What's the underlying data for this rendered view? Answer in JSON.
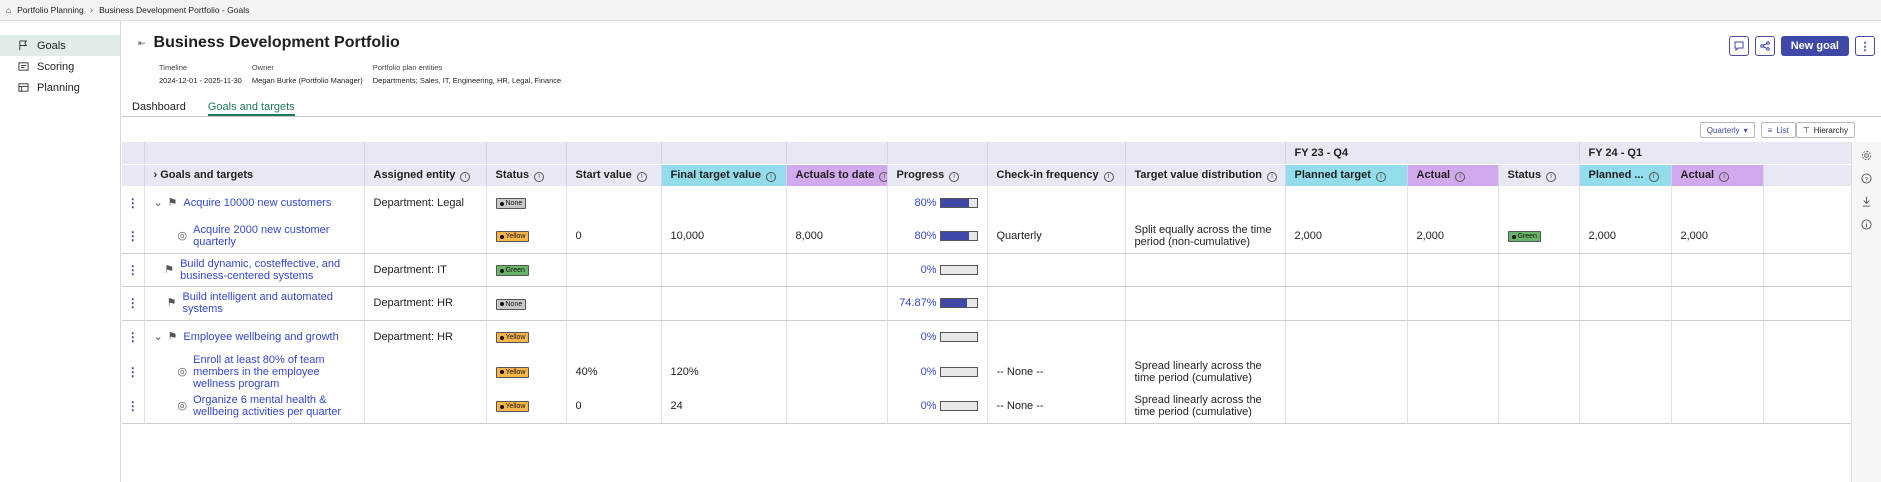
{
  "breadcrumb": {
    "root": "Portfolio Planning",
    "current": "Business Development Portfolio - Goals"
  },
  "sidebar": {
    "items": [
      {
        "label": "Goals",
        "active": true
      },
      {
        "label": "Scoring"
      },
      {
        "label": "Planning"
      }
    ]
  },
  "header": {
    "title": "Business Development Portfolio",
    "timeline_label": "Timeline",
    "timeline_value": "2024-12-01 - 2025-11-30",
    "owner_label": "Owner",
    "owner_value": "Megan Burke (Portfolio Manager)",
    "entities_label": "Portfolio plan entities",
    "entities_value": "Departments; Sales, IT, Engineering, HR, Legal, Finance",
    "new_goal_label": "New goal"
  },
  "tabs": [
    {
      "label": "Dashboard"
    },
    {
      "label": "Goals and targets",
      "active": true
    }
  ],
  "toolbar": {
    "period_select": "Quarterly",
    "list_label": "List",
    "hierarchy_label": "Hierarchy"
  },
  "columns": {
    "goals": "Goals and targets",
    "entity": "Assigned entity",
    "status": "Status",
    "start": "Start value",
    "final": "Final target value",
    "actuals": "Actuals to date",
    "progress": "Progress",
    "checkin": "Check-in frequency",
    "distribution": "Target value distribution",
    "p1_title": "FY 23 - Q4",
    "p1_planned": "Planned target",
    "p1_actual": "Actual",
    "p1_status": "Status",
    "p2_title": "FY 24 - Q1",
    "p2_planned": "Planned ...",
    "p2_actual": "Actual"
  },
  "rows": [
    {
      "goal": "Acquire 10000 new customers",
      "entity": "Department: Legal",
      "status": "None",
      "start": "",
      "final": "",
      "actuals": "",
      "progress": "80%",
      "checkin": "",
      "distribution": "",
      "p1_planned": "",
      "p1_actual": "",
      "p1_status": "",
      "p2_planned": "",
      "p2_actual": ""
    },
    {
      "goal": "Acquire 2000 new customer quarterly",
      "entity": "",
      "status": "Yellow",
      "start": "0",
      "final": "10,000",
      "actuals": "8,000",
      "progress": "80%",
      "checkin": "Quarterly",
      "distribution": "Split equally across the time period (non-cumulative)",
      "p1_planned": "2,000",
      "p1_actual": "2,000",
      "p1_status": "Green",
      "p2_planned": "2,000",
      "p2_actual": "2,000"
    },
    {
      "goal": "Build dynamic, costeffective, and business-centered systems",
      "entity": "Department: IT",
      "status": "Green",
      "start": "",
      "final": "",
      "actuals": "",
      "progress": "0%",
      "checkin": "",
      "distribution": "",
      "p1_planned": "",
      "p1_actual": "",
      "p1_status": "",
      "p2_planned": "",
      "p2_actual": ""
    },
    {
      "goal": "Build intelligent and automated systems",
      "entity": "Department: HR",
      "status": "None",
      "start": "",
      "final": "",
      "actuals": "",
      "progress": "74.87%",
      "checkin": "",
      "distribution": "",
      "p1_planned": "",
      "p1_actual": "",
      "p1_status": "",
      "p2_planned": "",
      "p2_actual": ""
    },
    {
      "goal": "Employee wellbeing and growth",
      "entity": "Department: HR",
      "status": "Yellow",
      "start": "",
      "final": "",
      "actuals": "",
      "progress": "0%",
      "checkin": "",
      "distribution": "",
      "p1_planned": "",
      "p1_actual": "",
      "p1_status": "",
      "p2_planned": "",
      "p2_actual": ""
    },
    {
      "goal": "Enroll at least 80% of team members in the employee wellness program",
      "entity": "",
      "status": "Yellow",
      "start": "40%",
      "final": "120%",
      "actuals": "",
      "progress": "0%",
      "checkin": "-- None --",
      "distribution": "Spread linearly across the time period (cumulative)",
      "p1_planned": "",
      "p1_actual": "",
      "p1_status": "",
      "p2_planned": "",
      "p2_actual": ""
    },
    {
      "goal": "Organize 6 mental health & wellbeing activities per quarter",
      "entity": "",
      "status": "Yellow",
      "start": "0",
      "final": "24",
      "actuals": "",
      "progress": "0%",
      "checkin": "-- None --",
      "distribution": "Spread linearly across the time period (cumulative)",
      "p1_planned": "",
      "p1_actual": "",
      "p1_status": "",
      "p2_planned": "",
      "p2_actual": ""
    }
  ],
  "progress_values": [
    0.8,
    0.8,
    0.0,
    0.7487,
    0.0,
    0.0,
    0.0
  ],
  "colors": {
    "accent": "#3f48a6",
    "link": "#3448c8",
    "tab_active": "#1c7a55",
    "cyan_header": "#92dceb",
    "purple_header": "#d1a9ec",
    "yellow": "#f7b54a",
    "green": "#6ab46a",
    "none": "#c9c9c9"
  }
}
